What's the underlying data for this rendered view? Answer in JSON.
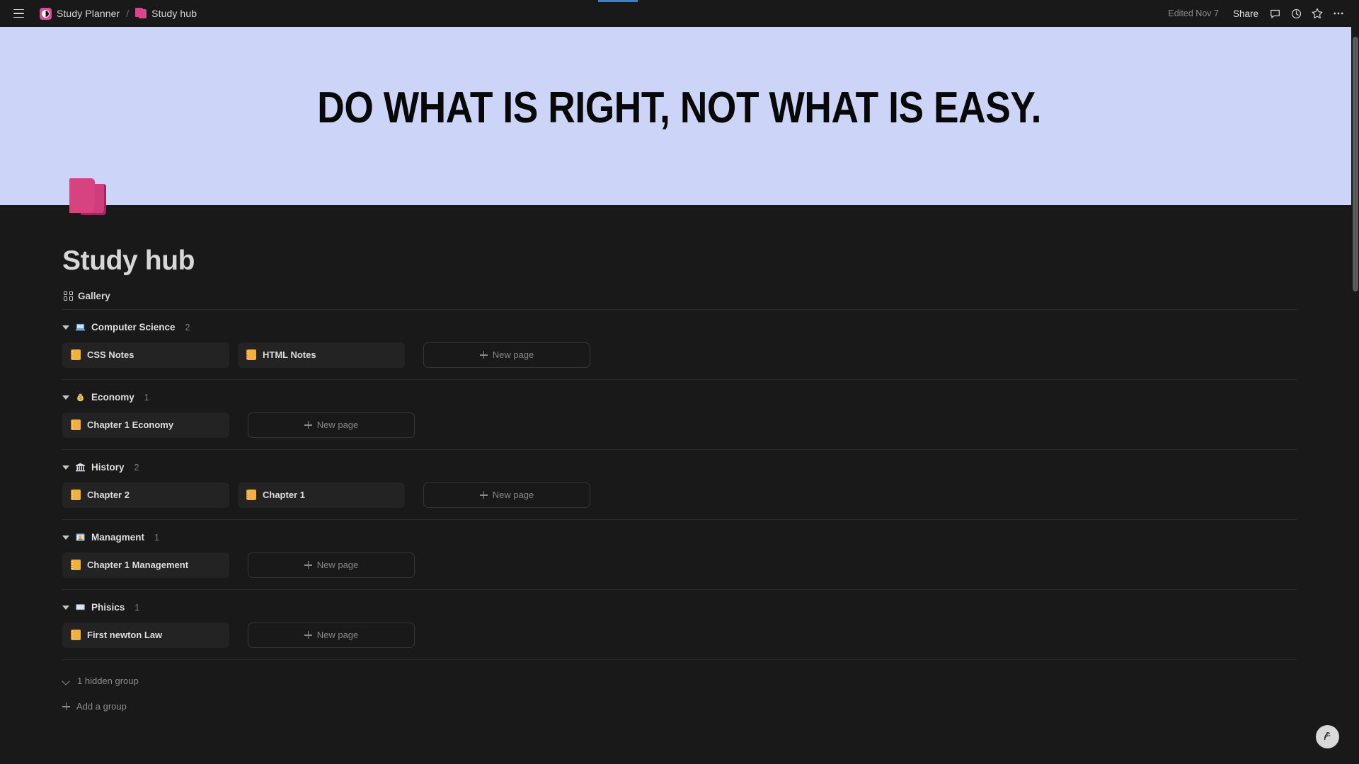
{
  "topbar": {
    "menu_icon": "hamburger-icon",
    "breadcrumb": [
      {
        "icon": "study-planner-icon",
        "label": "Study Planner"
      },
      {
        "icon": "study-hub-icon",
        "label": "Study hub"
      }
    ],
    "separator": "/",
    "edited_label": "Edited Nov 7",
    "share_label": "Share",
    "icons": [
      "comment-icon",
      "history-icon",
      "star-icon",
      "more-options-icon"
    ]
  },
  "cover": {
    "text": "DO WHAT IS RIGHT, NOT WHAT IS EASY.",
    "background_color": "#ccd5f8",
    "text_color": "#080808"
  },
  "page": {
    "emoji": "pink-notebook-icon",
    "title": "Study hub"
  },
  "view": {
    "icon": "gallery-grid-icon",
    "label": "Gallery"
  },
  "groups": [
    {
      "name": "Computer Science",
      "emoji": "laptop-icon",
      "emoji_char": "💻",
      "count": "2",
      "cards": [
        {
          "icon": "notebook-icon",
          "label": "CSS Notes"
        },
        {
          "icon": "notebook-icon",
          "label": "HTML Notes"
        }
      ],
      "new_page_label": "New page"
    },
    {
      "name": "Economy",
      "emoji": "money-bag-icon",
      "emoji_char": "💰",
      "count": "1",
      "cards": [
        {
          "icon": "notebook-icon",
          "label": "Chapter 1 Economy"
        }
      ],
      "new_page_label": "New page"
    },
    {
      "name": "History",
      "emoji": "classical-building-icon",
      "emoji_char": "🏛",
      "count": "2",
      "cards": [
        {
          "icon": "notebook-icon",
          "label": "Chapter 2"
        },
        {
          "icon": "notebook-icon",
          "label": "Chapter 1"
        }
      ],
      "new_page_label": "New page"
    },
    {
      "name": "Managment",
      "emoji": "office-worker-icon",
      "emoji_char": "🗂",
      "count": "1",
      "cards": [
        {
          "icon": "notebook-icon",
          "label": "Chapter 1 Management"
        }
      ],
      "new_page_label": "New page"
    },
    {
      "name": "Phisics",
      "emoji": "screen-icon",
      "emoji_char": "💻",
      "count": "1",
      "cards": [
        {
          "icon": "notebook-icon",
          "label": "First newton Law"
        }
      ],
      "new_page_label": "New page"
    }
  ],
  "footer": {
    "hidden_group_label": "1 hidden group",
    "add_group_label": "Add a group"
  },
  "help": {
    "icon": "help-assistant-icon"
  }
}
